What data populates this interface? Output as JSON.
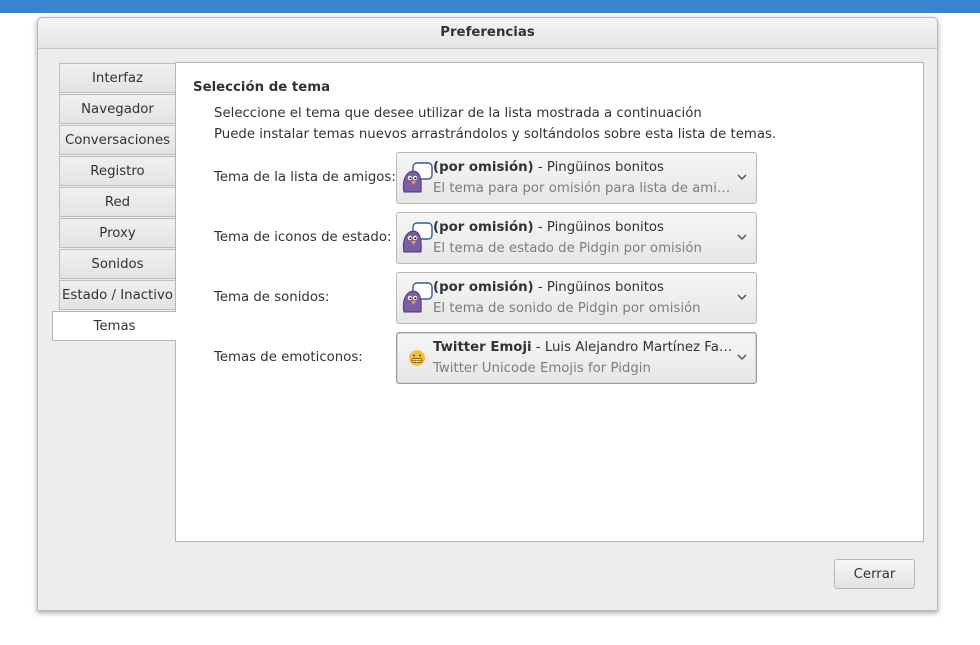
{
  "window": {
    "title": "Preferencias"
  },
  "tabs": [
    {
      "label": "Interfaz"
    },
    {
      "label": "Navegador"
    },
    {
      "label": "Conversaciones"
    },
    {
      "label": "Registro"
    },
    {
      "label": "Red"
    },
    {
      "label": "Proxy"
    },
    {
      "label": "Sonidos"
    },
    {
      "label": "Estado / Inactivo"
    },
    {
      "label": "Temas"
    }
  ],
  "active_tab": "Temas",
  "panel": {
    "section_title": "Selección de tema",
    "desc1": "Seleccione el tema que desee utilizar de la lista mostrada a continuación",
    "desc2": "Puede instalar temas nuevos arrastrándolos y soltándolos sobre esta lista de temas.",
    "rows": [
      {
        "label": "Tema de la lista de amigos:",
        "name_bold": "(por omisión)",
        "name_rest": " - Pingüinos bonitos",
        "detail": "El tema para por omisión para lista de amigo...",
        "icon": "pidgin-icon"
      },
      {
        "label": "Tema de iconos de estado:",
        "name_bold": "(por omisión)",
        "name_rest": " - Pingüinos bonitos",
        "detail": "El tema de estado de Pidgin por omisión",
        "icon": "pidgin-icon"
      },
      {
        "label": "Tema de sonidos:",
        "name_bold": "(por omisión)",
        "name_rest": " - Pingüinos bonitos",
        "detail": "El tema de sonido de Pidgin por omisión",
        "icon": "pidgin-icon"
      },
      {
        "label": "Temas de emoticonos:",
        "name_bold": "Twitter Emoji",
        "name_rest": " - Luis Alejandro Martínez Fan...",
        "detail": "Twitter Unicode Emojis for Pidgin",
        "icon": "grimace-emoji-icon"
      }
    ]
  },
  "buttons": {
    "close": "Cerrar"
  },
  "colors": {
    "topbar": "#3a84cf",
    "window_bg": "#ededed",
    "pidgin_purple": "#7a5ea3",
    "emoji_yellow": "#f7c33a"
  }
}
